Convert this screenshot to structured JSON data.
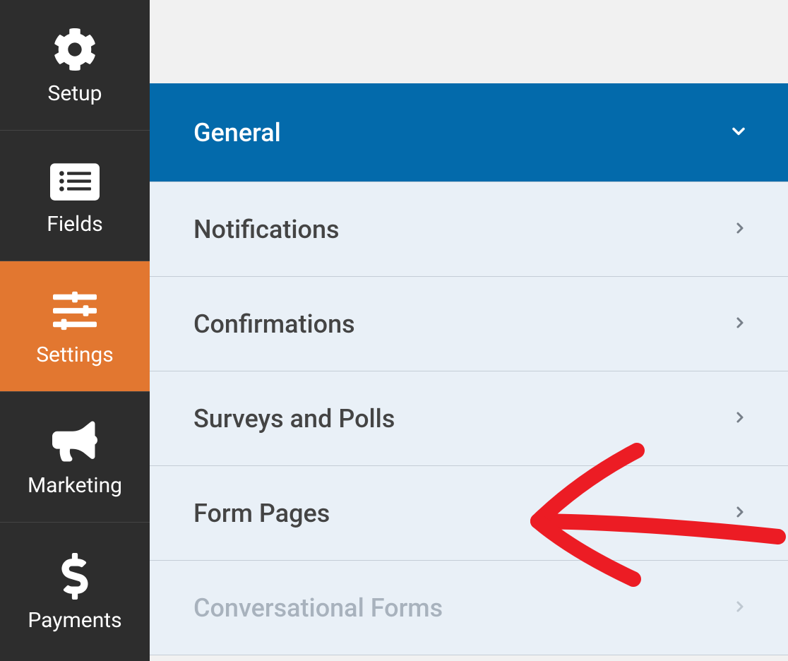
{
  "sidebar": {
    "items": [
      {
        "label": "Setup",
        "icon": "gear-icon",
        "active": false
      },
      {
        "label": "Fields",
        "icon": "list-icon",
        "active": false
      },
      {
        "label": "Settings",
        "icon": "sliders-icon",
        "active": true
      },
      {
        "label": "Marketing",
        "icon": "bullhorn-icon",
        "active": false
      },
      {
        "label": "Payments",
        "icon": "dollar-icon",
        "active": false
      }
    ]
  },
  "settings": {
    "items": [
      {
        "label": "General",
        "expanded": true,
        "disabled": false
      },
      {
        "label": "Notifications",
        "expanded": false,
        "disabled": false
      },
      {
        "label": "Confirmations",
        "expanded": false,
        "disabled": false
      },
      {
        "label": "Surveys and Polls",
        "expanded": false,
        "disabled": false
      },
      {
        "label": "Form Pages",
        "expanded": false,
        "disabled": false
      },
      {
        "label": "Conversational Forms",
        "expanded": false,
        "disabled": true
      }
    ]
  },
  "annotation": {
    "target": "Form Pages"
  }
}
